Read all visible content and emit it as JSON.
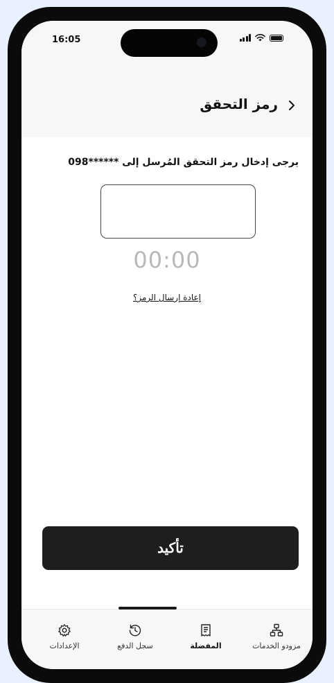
{
  "status_bar": {
    "time": "16:05"
  },
  "header": {
    "title": "رمز التحقق"
  },
  "verification": {
    "instruction": "يرجى إدخال رمز التحقق المُرسل إلى ******098",
    "code_value": "",
    "timer": "00:00",
    "resend_label": "إعادة إرسال الرمز؟"
  },
  "actions": {
    "confirm_label": "تأكيد"
  },
  "bottom_nav": {
    "items": [
      {
        "label": "مزودو الخدمات",
        "icon": "sitemap-icon"
      },
      {
        "label": "المفضلة",
        "icon": "receipt-icon",
        "active": true
      },
      {
        "label": "سجل الدفع",
        "icon": "history-icon"
      },
      {
        "label": "الإعدادات",
        "icon": "gear-icon"
      }
    ]
  }
}
